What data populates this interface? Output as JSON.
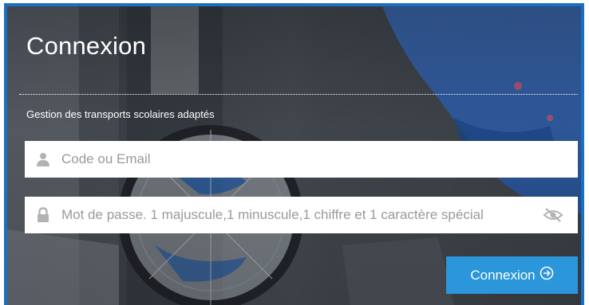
{
  "login": {
    "title": "Connexion",
    "subtitle": "Gestion des transports scolaires adaptés",
    "code_field": {
      "value": "",
      "placeholder": "Code ou Email",
      "icon": "user-icon"
    },
    "password_field": {
      "value": "",
      "placeholder": "Mot de passe. 1 majuscule,1 minuscule,1 chiffre et 1 caractère spécial",
      "icon": "lock-icon",
      "toggle_icon": "eye-slash-icon"
    },
    "submit": {
      "label": "Connexion",
      "icon": "circle-arrow-right-icon"
    }
  },
  "colors": {
    "frame": "#1a6fbe",
    "button": "#2b96d9",
    "icon_gray": "#b3b3b3",
    "text": "#ffffff"
  }
}
